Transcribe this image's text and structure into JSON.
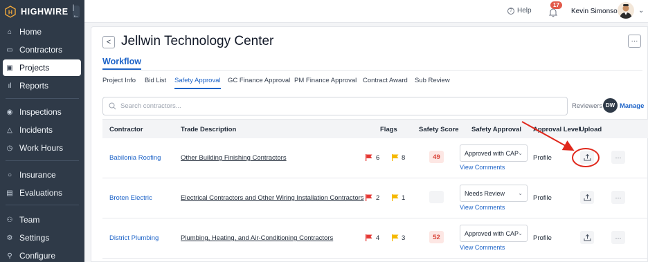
{
  "brand": {
    "name": "HIGHWIRE",
    "logo_letter": "H",
    "collapse_glyph": "|←"
  },
  "sidebar": {
    "items": [
      {
        "label": "Home",
        "icon": "home-icon",
        "glyph": "⌂"
      },
      {
        "label": "Contractors",
        "icon": "id-card-icon",
        "glyph": "▭"
      },
      {
        "label": "Projects",
        "icon": "briefcase-icon",
        "glyph": "▣",
        "active": true
      },
      {
        "label": "Reports",
        "icon": "bar-chart-icon",
        "glyph": "ıl"
      },
      {
        "label": "Inspections",
        "icon": "eye-icon",
        "glyph": "◉"
      },
      {
        "label": "Incidents",
        "icon": "warning-icon",
        "glyph": "△"
      },
      {
        "label": "Work Hours",
        "icon": "clock-icon",
        "glyph": "◷"
      },
      {
        "label": "Insurance",
        "icon": "circle-icon",
        "glyph": "○"
      },
      {
        "label": "Evaluations",
        "icon": "clipboard-icon",
        "glyph": "▤"
      },
      {
        "label": "Team",
        "icon": "team-icon",
        "glyph": "⚇"
      },
      {
        "label": "Settings",
        "icon": "gear-icon",
        "glyph": "⚙"
      },
      {
        "label": "Configure",
        "icon": "configure-icon",
        "glyph": "⚲"
      }
    ]
  },
  "topbar": {
    "help_label": "Help",
    "help_glyph": "?",
    "notifications_count": "17",
    "user_name": "Kevin Simonson",
    "chevron_glyph": "⌄"
  },
  "page": {
    "back_glyph": "<",
    "title": "Jellwin Technology Center",
    "more_glyph": "···",
    "section": "Workflow"
  },
  "tabs": [
    {
      "label": "Project Info"
    },
    {
      "label": "Bid List"
    },
    {
      "label": "Safety Approval",
      "active": true
    },
    {
      "label": "GC Finance Approval"
    },
    {
      "label": "PM Finance Approval"
    },
    {
      "label": "Contract Award"
    },
    {
      "label": "Sub Review"
    }
  ],
  "search": {
    "placeholder": "Search contractors..."
  },
  "reviewers": {
    "label": "Reviewers",
    "avatar_initials": "DW",
    "manage_label": "Manage"
  },
  "table": {
    "headers": {
      "contractor": "Contractor",
      "trade": "Trade Description",
      "flags": "Flags",
      "score": "Safety Score",
      "approval": "Safety Approval",
      "level": "Approval Level",
      "upload": "Upload"
    },
    "rows": [
      {
        "contractor": "Babilonia Roofing",
        "trade": "Other Building Finishing Contractors",
        "red_flags": "6",
        "yellow_flags": "8",
        "score": "49",
        "approval": "Approved with CAP",
        "view_comments": "View Comments",
        "level": "Profile",
        "more": "···"
      },
      {
        "contractor": "Broten Electric",
        "trade": "Electrical Contractors and Other Wiring Installation Contractors",
        "red_flags": "2",
        "yellow_flags": "1",
        "score": "",
        "approval": "Needs Review",
        "view_comments": "View Comments",
        "level": "Profile",
        "more": "···"
      },
      {
        "contractor": "District Plumbing",
        "trade": "Plumbing, Heating, and Air-Conditioning Contractors",
        "red_flags": "4",
        "yellow_flags": "3",
        "score": "52",
        "approval": "Approved with CAP",
        "view_comments": "View Comments",
        "level": "Profile",
        "more": "···"
      }
    ],
    "caret_glyph": "⌄"
  },
  "colors": {
    "sidebar_bg": "#2f3a48",
    "accent": "#1e64c8",
    "brand_gold": "#f2a93b",
    "red_flag": "#e53935",
    "yellow_flag": "#f5b800",
    "score_red": "#d9463b",
    "annotation_red": "#e0281c"
  }
}
